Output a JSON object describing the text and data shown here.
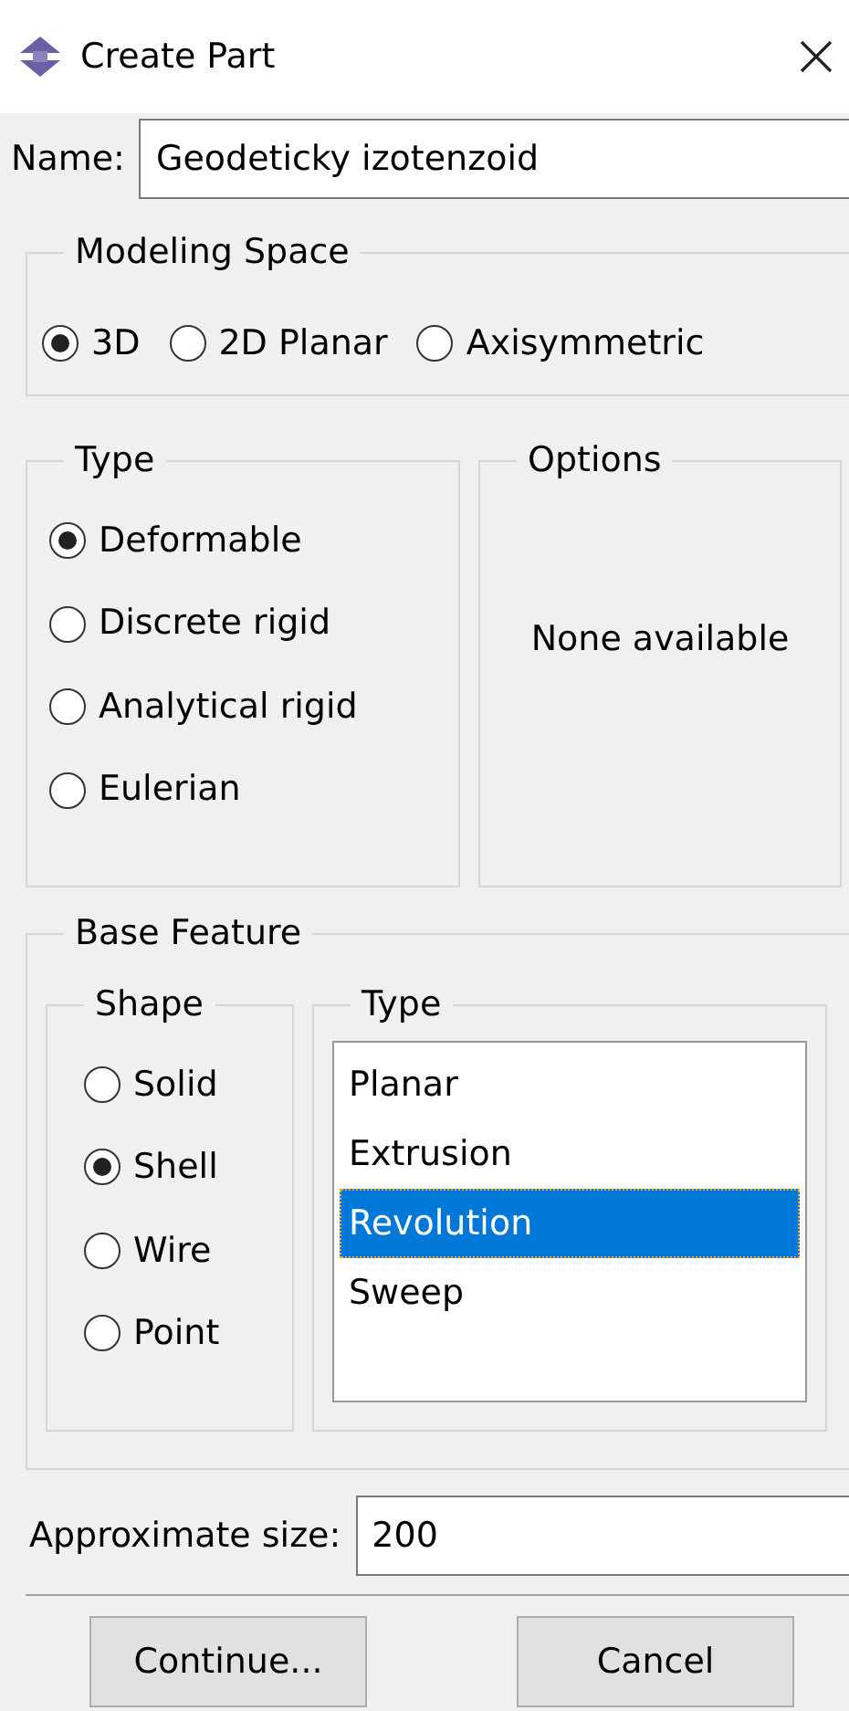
{
  "window": {
    "title": "Create Part"
  },
  "name": {
    "label": "Name:",
    "value": "Geodeticky izotenzoid"
  },
  "modeling_space": {
    "title": "Modeling Space",
    "options": [
      {
        "label": "3D",
        "selected": true
      },
      {
        "label": "2D Planar",
        "selected": false
      },
      {
        "label": "Axisymmetric",
        "selected": false
      }
    ]
  },
  "type": {
    "title": "Type",
    "options": [
      {
        "label": "Deformable",
        "selected": true
      },
      {
        "label": "Discrete rigid",
        "selected": false
      },
      {
        "label": "Analytical rigid",
        "selected": false
      },
      {
        "label": "Eulerian",
        "selected": false
      }
    ]
  },
  "options": {
    "title": "Options",
    "message": "None available"
  },
  "base_feature": {
    "title": "Base Feature",
    "shape": {
      "title": "Shape",
      "options": [
        {
          "label": "Solid",
          "selected": false
        },
        {
          "label": "Shell",
          "selected": true
        },
        {
          "label": "Wire",
          "selected": false
        },
        {
          "label": "Point",
          "selected": false
        }
      ]
    },
    "type": {
      "title": "Type",
      "items": [
        {
          "label": "Planar",
          "selected": false
        },
        {
          "label": "Extrusion",
          "selected": false
        },
        {
          "label": "Revolution",
          "selected": true
        },
        {
          "label": "Sweep",
          "selected": false
        }
      ]
    }
  },
  "approximate_size": {
    "label": "Approximate size:",
    "value": "200"
  },
  "buttons": [
    "Continue...",
    "Cancel"
  ]
}
